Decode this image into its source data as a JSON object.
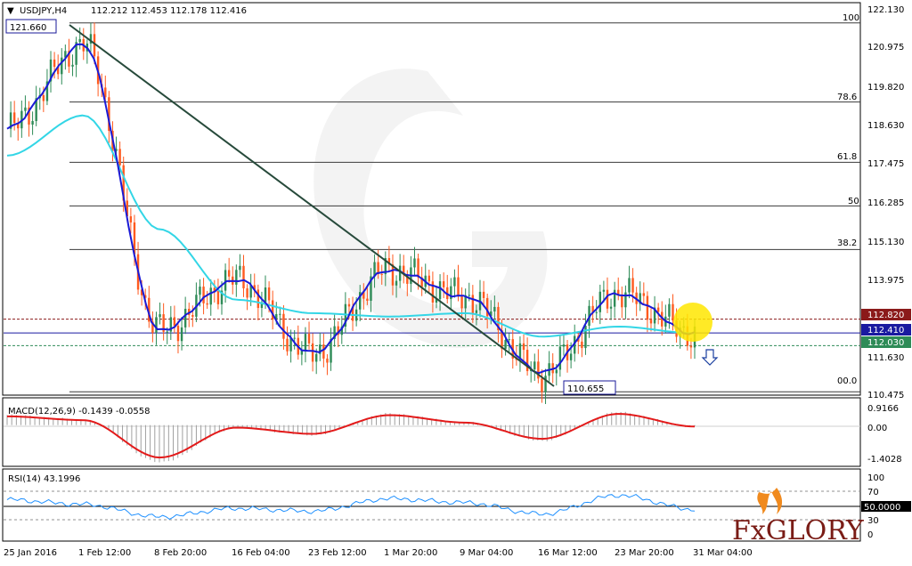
{
  "header": {
    "symbol": "USDJPY,H4",
    "ohlc": "112.212 112.453 112.178 112.416"
  },
  "price_labels": {
    "high_box": "121.660",
    "low_box": "110.655",
    "resistance": "112.820",
    "current": "112.410",
    "support": "112.030"
  },
  "fib_labels": [
    "100",
    "78.6",
    "61.8",
    "50",
    "38.2",
    "00.0"
  ],
  "price_axis_ticks": [
    "122.130",
    "120.975",
    "119.820",
    "118.630",
    "117.475",
    "116.285",
    "115.130",
    "113.975",
    "111.630",
    "110.475"
  ],
  "macd": {
    "label": "MACD(12,26,9) -0.1439 -0.0558",
    "ticks": [
      "0.9166",
      "0.00",
      "-1.4028"
    ]
  },
  "rsi": {
    "label": "RSI(14) 43.1996",
    "ticks": [
      "100",
      "70",
      "50.0000",
      "30",
      "0"
    ]
  },
  "time_axis": [
    "25 Jan 2016",
    "1 Feb 12:00",
    "8 Feb 20:00",
    "16 Feb 04:00",
    "23 Feb 12:00",
    "1 Mar 20:00",
    "9 Mar 04:00",
    "16 Mar 12:00",
    "23 Mar 20:00",
    "31 Mar 04:00"
  ],
  "logo": {
    "text": "FxGLORY"
  },
  "colors": {
    "bull": "#2e8b57",
    "bear": "#ff5a1f",
    "fast_ma": "#1a1ad6",
    "slow_ma": "#33d6e6",
    "trendline": "#274a3b",
    "resistance": "#8b1a1a",
    "current": "#1a1aa0",
    "support": "#2e8b57",
    "macd_signal": "#e31a1a",
    "macd_hist": "#a0a0a0",
    "rsi_line": "#1e90ff",
    "highlight": "#ffe600"
  },
  "chart_data": [
    {
      "type": "line",
      "panel": "price",
      "ylim": [
        110.475,
        122.13
      ],
      "x": [
        "25 Jan 2016",
        "1 Feb 12:00",
        "8 Feb 20:00",
        "16 Feb 04:00",
        "23 Feb 12:00",
        "1 Mar 20:00",
        "9 Mar 04:00",
        "16 Mar 12:00",
        "23 Mar 20:00",
        "31 Mar 04:00"
      ],
      "series": [
        {
          "values": [
            118.5,
            121.0,
            112.5,
            114.0,
            111.8,
            114.3,
            113.5,
            111.2,
            113.6,
            112.4
          ]
        },
        {
          "values": [
            117.7,
            118.9,
            115.5,
            113.4,
            113.0,
            112.9,
            113.0,
            112.3,
            112.6,
            112.4
          ]
        }
      ],
      "fibonacci": {
        "100": 121.66,
        "78.6": 119.3,
        "61.8": 117.5,
        "50": 116.2,
        "38.2": 114.9,
        "00.0": 110.655
      },
      "levels": {
        "resistance": 112.82,
        "current": 112.41,
        "support": 112.03
      }
    },
    {
      "type": "line",
      "panel": "macd",
      "ylim": [
        -1.4028,
        0.9166
      ],
      "x": [
        "25 Jan 2016",
        "1 Feb 12:00",
        "8 Feb 20:00",
        "16 Feb 04:00",
        "23 Feb 12:00",
        "1 Mar 20:00",
        "9 Mar 04:00",
        "16 Mar 12:00",
        "23 Mar 20:00",
        "31 Mar 04:00"
      ],
      "values": [
        0.35,
        0.2,
        -1.3,
        -0.1,
        -0.35,
        0.4,
        0.1,
        -0.55,
        0.45,
        -0.0558
      ]
    },
    {
      "type": "line",
      "panel": "rsi",
      "ylim": [
        0,
        100
      ],
      "x": [
        "25 Jan 2016",
        "1 Feb 12:00",
        "8 Feb 20:00",
        "16 Feb 04:00",
        "23 Feb 12:00",
        "1 Mar 20:00",
        "9 Mar 04:00",
        "16 Mar 12:00",
        "23 Mar 20:00",
        "31 Mar 04:00"
      ],
      "values": [
        60,
        52,
        30,
        45,
        40,
        62,
        55,
        35,
        68,
        43.2
      ]
    }
  ]
}
